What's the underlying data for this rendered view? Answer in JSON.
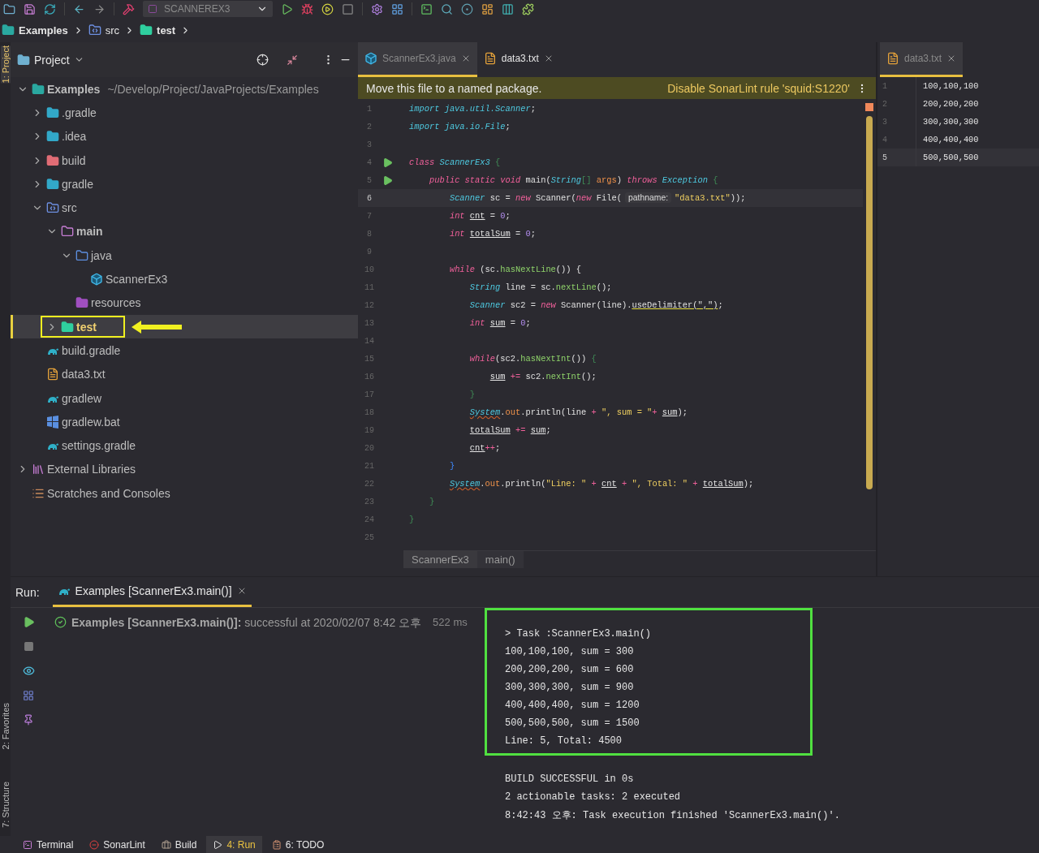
{
  "toolbar": {
    "run_config": "SCANNEREX3"
  },
  "breadcrumb": [
    {
      "label": "Examples",
      "kind": "module"
    },
    {
      "label": "src",
      "kind": "src-folder"
    },
    {
      "label": "test",
      "kind": "test-folder"
    }
  ],
  "side_bar": {
    "top": [
      {
        "label": "1: Project",
        "selected": true
      }
    ],
    "bottom": [
      {
        "label": "2: Favorites",
        "selected": false
      },
      {
        "label": "7: Structure",
        "selected": false
      }
    ]
  },
  "project": {
    "title": "Project",
    "tree": [
      {
        "label": "Examples",
        "detail": "~/Develop/Project/JavaProjects/Examples",
        "kind": "module",
        "bold": true,
        "expanded": true,
        "selected": false,
        "children": [
          {
            "label": ".gradle",
            "kind": "gradle-folder",
            "expanded": false,
            "selected": false
          },
          {
            "label": ".idea",
            "kind": "idea-folder",
            "expanded": false,
            "selected": false
          },
          {
            "label": "build",
            "kind": "build-folder",
            "expanded": false,
            "selected": false
          },
          {
            "label": "gradle",
            "kind": "gradle-folder",
            "expanded": false,
            "selected": false
          },
          {
            "label": "src",
            "kind": "src-folder",
            "expanded": true,
            "selected": false,
            "children": [
              {
                "label": "main",
                "kind": "folder",
                "bold": true,
                "expanded": true,
                "selected": false,
                "children": [
                  {
                    "label": "java",
                    "kind": "source-folder",
                    "expanded": true,
                    "selected": false,
                    "children": [
                      {
                        "label": "ScannerEx3",
                        "kind": "class",
                        "selected": false
                      }
                    ]
                  },
                  {
                    "label": "resources",
                    "kind": "resources-folder",
                    "selected": false
                  }
                ]
              },
              {
                "label": "test",
                "kind": "test-folder",
                "expanded": false,
                "selected": true,
                "callout": true
              }
            ]
          },
          {
            "label": "build.gradle",
            "kind": "gradle-file",
            "selected": false
          },
          {
            "label": "data3.txt",
            "kind": "text-file",
            "selected": false
          },
          {
            "label": "gradlew",
            "kind": "gradle-file",
            "selected": false
          },
          {
            "label": "gradlew.bat",
            "kind": "windows-file",
            "selected": false
          },
          {
            "label": "settings.gradle",
            "kind": "gradle-file",
            "selected": false
          }
        ]
      },
      {
        "label": "External Libraries",
        "kind": "library",
        "expanded": false,
        "selected": false
      },
      {
        "label": "Scratches and Consoles",
        "kind": "scratches",
        "selected": false
      }
    ]
  },
  "editor": {
    "tabs": [
      {
        "label": "ScannerEx3.java",
        "kind": "class",
        "selected": true
      },
      {
        "label": "data3.txt",
        "kind": "text-file",
        "selected": false
      }
    ],
    "banner": {
      "message": "Move this file to a named package.",
      "action": "Disable SonarLint rule 'squid:S1220'"
    },
    "lines": [
      {
        "number": "1",
        "run": false,
        "current": false,
        "tokens": [
          {
            "kind": "type",
            "text": "import java.util.Scanner"
          },
          {
            "kind": "plain",
            "text": ";"
          }
        ]
      },
      {
        "number": "2",
        "run": false,
        "current": false,
        "tokens": [
          {
            "kind": "type",
            "text": "import java.io.File"
          },
          {
            "kind": "plain",
            "text": ";"
          }
        ]
      },
      {
        "number": "3",
        "run": false,
        "current": false
      },
      {
        "number": "4",
        "run": true,
        "current": false,
        "tokens": [
          {
            "kind": "kw",
            "text": "class "
          },
          {
            "kind": "type",
            "text": "ScannerEx3 "
          },
          {
            "kind": "brace",
            "text": "{"
          }
        ]
      },
      {
        "number": "5",
        "run": true,
        "current": false,
        "tokens": [
          {
            "kind": "kw",
            "text": "    public static void "
          },
          {
            "kind": "plain",
            "text": "main("
          },
          {
            "kind": "type",
            "text": "String"
          },
          {
            "kind": "brace",
            "text": "[] "
          },
          {
            "kind": "field",
            "text": "args"
          },
          {
            "kind": "plain",
            "text": ") "
          },
          {
            "kind": "kw",
            "text": "throws "
          },
          {
            "kind": "type",
            "text": "Exception "
          },
          {
            "kind": "brace",
            "text": "{"
          }
        ]
      },
      {
        "number": "6",
        "run": false,
        "current": true,
        "tokens": [
          {
            "kind": "type",
            "text": "        Scanner "
          },
          {
            "kind": "plain",
            "text": "sc = "
          },
          {
            "kind": "kw",
            "text": "new "
          },
          {
            "kind": "plain",
            "text": "Scanner("
          },
          {
            "kind": "kw",
            "text": "new "
          },
          {
            "kind": "plain",
            "text": "File("
          },
          {
            "kind": "hint",
            "text": "pathname:"
          },
          {
            "kind": "str",
            "text": "\"data3.txt\""
          },
          {
            "kind": "plain",
            "text": "));"
          }
        ]
      },
      {
        "number": "7",
        "run": false,
        "current": false,
        "tokens": [
          {
            "kind": "kw",
            "text": "        int "
          },
          {
            "kind": "var",
            "text": "cnt"
          },
          {
            "kind": "plain",
            "text": " = "
          },
          {
            "kind": "num",
            "text": "0"
          },
          {
            "kind": "plain",
            "text": ";"
          }
        ]
      },
      {
        "number": "8",
        "run": false,
        "current": false,
        "tokens": [
          {
            "kind": "kw",
            "text": "        int "
          },
          {
            "kind": "var",
            "text": "totalSum"
          },
          {
            "kind": "plain",
            "text": " = "
          },
          {
            "kind": "num",
            "text": "0"
          },
          {
            "kind": "plain",
            "text": ";"
          }
        ]
      },
      {
        "number": "9",
        "run": false,
        "current": false
      },
      {
        "number": "10",
        "run": false,
        "current": false,
        "tokens": [
          {
            "kind": "kw",
            "text": "        while "
          },
          {
            "kind": "plain",
            "text": "(sc."
          },
          {
            "kind": "call",
            "text": "hasNextLine"
          },
          {
            "kind": "plain",
            "text": "()) {"
          }
        ]
      },
      {
        "number": "11",
        "run": false,
        "current": false,
        "tokens": [
          {
            "kind": "type",
            "text": "            String "
          },
          {
            "kind": "plain",
            "text": "line = sc."
          },
          {
            "kind": "call",
            "text": "nextLine"
          },
          {
            "kind": "plain",
            "text": "();"
          }
        ]
      },
      {
        "number": "12",
        "run": false,
        "current": false,
        "tokens": [
          {
            "kind": "type",
            "text": "            Scanner "
          },
          {
            "kind": "plain",
            "text": "sc2 = "
          },
          {
            "kind": "kw",
            "text": "new "
          },
          {
            "kind": "plain",
            "text": "Scanner(line)."
          },
          {
            "kind": "warn",
            "text": "useDelimiter(\",\")"
          },
          {
            "kind": "plain",
            "text": ";"
          }
        ]
      },
      {
        "number": "13",
        "run": false,
        "current": false,
        "tokens": [
          {
            "kind": "kw",
            "text": "            int "
          },
          {
            "kind": "var",
            "text": "sum"
          },
          {
            "kind": "plain",
            "text": " = "
          },
          {
            "kind": "num",
            "text": "0"
          },
          {
            "kind": "plain",
            "text": ";"
          }
        ]
      },
      {
        "number": "14",
        "run": false,
        "current": false
      },
      {
        "number": "15",
        "run": false,
        "current": false,
        "tokens": [
          {
            "kind": "kw",
            "text": "            while"
          },
          {
            "kind": "plain",
            "text": "(sc2."
          },
          {
            "kind": "call",
            "text": "hasNextInt"
          },
          {
            "kind": "plain",
            "text": "()) "
          },
          {
            "kind": "brace",
            "text": "{"
          }
        ]
      },
      {
        "number": "16",
        "run": false,
        "current": false,
        "tokens": [
          {
            "kind": "var",
            "text": "                sum"
          },
          {
            "kind": "op",
            "text": " += "
          },
          {
            "kind": "plain",
            "text": "sc2."
          },
          {
            "kind": "call",
            "text": "nextInt"
          },
          {
            "kind": "plain",
            "text": "();"
          }
        ]
      },
      {
        "number": "17",
        "run": false,
        "current": false,
        "tokens": [
          {
            "kind": "brace",
            "text": "            }"
          }
        ]
      },
      {
        "number": "18",
        "run": false,
        "current": false,
        "tokens": [
          {
            "kind": "sys",
            "text": "            System"
          },
          {
            "kind": "plain",
            "text": "."
          },
          {
            "kind": "field",
            "text": "out"
          },
          {
            "kind": "plain",
            "text": ".println(line "
          },
          {
            "kind": "op",
            "text": "+ "
          },
          {
            "kind": "str",
            "text": "\", sum = \""
          },
          {
            "kind": "op",
            "text": "+ "
          },
          {
            "kind": "var",
            "text": "sum"
          },
          {
            "kind": "plain",
            "text": ");"
          }
        ]
      },
      {
        "number": "19",
        "run": false,
        "current": false,
        "tokens": [
          {
            "kind": "var",
            "text": "            totalSum"
          },
          {
            "kind": "op",
            "text": " += "
          },
          {
            "kind": "var",
            "text": "sum"
          },
          {
            "kind": "plain",
            "text": ";"
          }
        ]
      },
      {
        "number": "20",
        "run": false,
        "current": false,
        "tokens": [
          {
            "kind": "var",
            "text": "            cnt"
          },
          {
            "kind": "op",
            "text": "++"
          },
          {
            "kind": "plain",
            "text": ";"
          }
        ]
      },
      {
        "number": "21",
        "run": false,
        "current": false,
        "tokens": [
          {
            "kind": "blue",
            "text": "        }"
          }
        ]
      },
      {
        "number": "22",
        "run": false,
        "current": false,
        "tokens": [
          {
            "kind": "sys",
            "text": "        System"
          },
          {
            "kind": "plain",
            "text": "."
          },
          {
            "kind": "field",
            "text": "out"
          },
          {
            "kind": "plain",
            "text": ".println("
          },
          {
            "kind": "str",
            "text": "\"Line: \" "
          },
          {
            "kind": "op",
            "text": "+ "
          },
          {
            "kind": "var",
            "text": "cnt"
          },
          {
            "kind": "op",
            "text": " + "
          },
          {
            "kind": "str",
            "text": "\", Total: \" "
          },
          {
            "kind": "op",
            "text": "+ "
          },
          {
            "kind": "var",
            "text": "totalSum"
          },
          {
            "kind": "plain",
            "text": ");"
          }
        ]
      },
      {
        "number": "23",
        "run": false,
        "current": false,
        "tokens": [
          {
            "kind": "brace",
            "text": "    }"
          }
        ]
      },
      {
        "number": "24",
        "run": false,
        "current": false,
        "tokens": [
          {
            "kind": "brace",
            "text": "}"
          }
        ]
      },
      {
        "number": "25",
        "run": false,
        "current": false
      }
    ],
    "breadcrumb": [
      "ScannerEx3",
      "main()"
    ]
  },
  "preview": {
    "tabs": [
      {
        "label": "data3.txt",
        "kind": "text-file",
        "selected": true
      }
    ],
    "lines": [
      {
        "number": "1",
        "text": "100,100,100",
        "current": false
      },
      {
        "number": "2",
        "text": "200,200,200",
        "current": false
      },
      {
        "number": "3",
        "text": "300,300,300",
        "current": false
      },
      {
        "number": "4",
        "text": "400,400,400",
        "current": false
      },
      {
        "number": "5",
        "text": "500,500,500",
        "current": true
      }
    ]
  },
  "run": {
    "label": "Run:",
    "tab": {
      "label": "Examples [ScannerEx3.main()]",
      "selected": true
    },
    "tree": {
      "kind": "success",
      "text": "**Examples [ScannerEx3.main()]:** successful at 2020/02/07 8:42 오후",
      "duration": "522 ms"
    },
    "output_highlighted": [
      "> Task :ScannerEx3.main()",
      "100,100,100, sum = 300",
      "200,200,200, sum = 600",
      "300,300,300, sum = 900",
      "400,400,400, sum = 1200",
      "500,500,500, sum = 1500",
      "Line: 5, Total: 4500"
    ],
    "output": [
      "BUILD SUCCESSFUL in 0s",
      "2 actionable tasks: 2 executed",
      "8:42:43 오후: Task execution finished 'ScannerEx3.main()'."
    ]
  },
  "tool_tabs": [
    {
      "label": "Terminal",
      "kind": "terminal",
      "selected": false
    },
    {
      "label": "SonarLint",
      "kind": "sonar",
      "selected": false
    },
    {
      "label": "Build",
      "kind": "build",
      "selected": false
    },
    {
      "label": "4: Run",
      "kind": "run",
      "selected": true
    },
    {
      "label": "6: TODO",
      "kind": "todo",
      "selected": false
    }
  ]
}
